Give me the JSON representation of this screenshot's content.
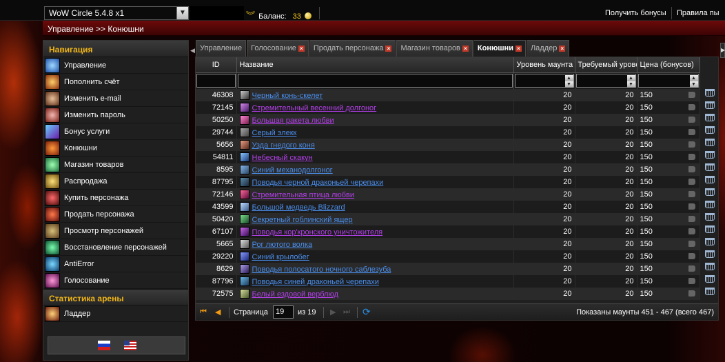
{
  "topbar": {
    "realm": "WoW Circle 5.4.8 x1",
    "balance_label": "Баланс:",
    "balance_value": "33",
    "get_bonuses": "Получить бонусы",
    "rules": "Правила пы"
  },
  "breadcrumb": "Управление >> Конюшни",
  "sidebar": {
    "nav_title": "Навигация",
    "items": [
      {
        "label": "Управление",
        "icon": "management-icon"
      },
      {
        "label": "Пополнить счёт",
        "icon": "replenish-icon"
      },
      {
        "label": "Изменить e-mail",
        "icon": "email-icon"
      },
      {
        "label": "Изменить пароль",
        "icon": "password-icon"
      },
      {
        "label": "Бонус услуги",
        "icon": "bonus-icon"
      },
      {
        "label": "Конюшни",
        "icon": "stables-icon"
      },
      {
        "label": "Магазин товаров",
        "icon": "shop-icon"
      },
      {
        "label": "Распродажа",
        "icon": "sale-icon"
      },
      {
        "label": "Купить персонажа",
        "icon": "buy-character-icon"
      },
      {
        "label": "Продать персонажа",
        "icon": "sell-character-icon"
      },
      {
        "label": "Просмотр персонажей",
        "icon": "view-characters-icon"
      },
      {
        "label": "Восстановление персонажей",
        "icon": "restore-icon"
      },
      {
        "label": "AntiError",
        "icon": "antierror-icon"
      },
      {
        "label": "Голосование",
        "icon": "vote-icon"
      }
    ],
    "arena_title": "Статистика арены",
    "arena_items": [
      {
        "label": "Ладдер",
        "icon": "ladder-icon"
      }
    ]
  },
  "tabs": [
    {
      "label": "Управление",
      "closable": false,
      "active": false
    },
    {
      "label": "Голосование",
      "closable": true,
      "active": false
    },
    {
      "label": "Продать персонажа",
      "closable": true,
      "active": false
    },
    {
      "label": "Магазин товаров",
      "closable": true,
      "active": false
    },
    {
      "label": "Конюшни",
      "closable": true,
      "active": true
    },
    {
      "label": "Ладдер",
      "closable": true,
      "active": false
    }
  ],
  "grid": {
    "columns": [
      "ID",
      "Название",
      "Уровень маунта",
      "Требуемый уровень",
      "Цена (бонусов)"
    ],
    "rows": [
      {
        "id": "46308",
        "name": "Черный конь-скелет",
        "color": "blue",
        "level": "20",
        "req": "20",
        "price": "150"
      },
      {
        "id": "72145",
        "name": "Стремительный весенний долгоног",
        "color": "purple",
        "level": "20",
        "req": "20",
        "price": "150"
      },
      {
        "id": "50250",
        "name": "Большая ракета любви",
        "color": "purple",
        "level": "20",
        "req": "20",
        "price": "150"
      },
      {
        "id": "29744",
        "name": "Серый элекк",
        "color": "blue",
        "level": "20",
        "req": "20",
        "price": "150"
      },
      {
        "id": "5656",
        "name": "Узда гнедого коня",
        "color": "blue",
        "level": "20",
        "req": "20",
        "price": "150"
      },
      {
        "id": "54811",
        "name": "Небесный скакун",
        "color": "purple",
        "level": "20",
        "req": "20",
        "price": "150"
      },
      {
        "id": "8595",
        "name": "Синий механодолгоног",
        "color": "blue",
        "level": "20",
        "req": "20",
        "price": "150"
      },
      {
        "id": "87795",
        "name": "Поводья черной драконьей черепахи",
        "color": "blue",
        "level": "20",
        "req": "20",
        "price": "150"
      },
      {
        "id": "72146",
        "name": "Стремительная птица любви",
        "color": "purple",
        "level": "20",
        "req": "20",
        "price": "150"
      },
      {
        "id": "43599",
        "name": "Большой медведь Blizzard",
        "color": "blue",
        "level": "20",
        "req": "20",
        "price": "150"
      },
      {
        "id": "50420",
        "name": "Секретный гоблинский ящер",
        "color": "blue",
        "level": "20",
        "req": "20",
        "price": "150"
      },
      {
        "id": "67107",
        "name": "Поводья кор'кронского уничтожителя",
        "color": "purple",
        "level": "20",
        "req": "20",
        "price": "150"
      },
      {
        "id": "5665",
        "name": "Рог лютого волка",
        "color": "blue",
        "level": "20",
        "req": "20",
        "price": "150"
      },
      {
        "id": "29220",
        "name": "Синий крылобег",
        "color": "blue",
        "level": "20",
        "req": "20",
        "price": "150"
      },
      {
        "id": "8629",
        "name": "Поводья полосатого ночного саблезуба",
        "color": "blue",
        "level": "20",
        "req": "20",
        "price": "150"
      },
      {
        "id": "87796",
        "name": "Поводья синей драконьей черепахи",
        "color": "blue",
        "level": "20",
        "req": "20",
        "price": "150"
      },
      {
        "id": "72575",
        "name": "Белый ездовой верблюд",
        "color": "purple",
        "level": "20",
        "req": "20",
        "price": "150"
      }
    ]
  },
  "pager": {
    "page_label": "Страница",
    "page_value": "19",
    "page_of": "из 19",
    "info": "Показаны маунты 451 - 467 (всего 467)"
  },
  "colors": {
    "accent_gold": "#f1b617",
    "link_blue": "#4a8dea",
    "link_purple": "#b23fe8",
    "header_red": "#6d0a0a"
  }
}
